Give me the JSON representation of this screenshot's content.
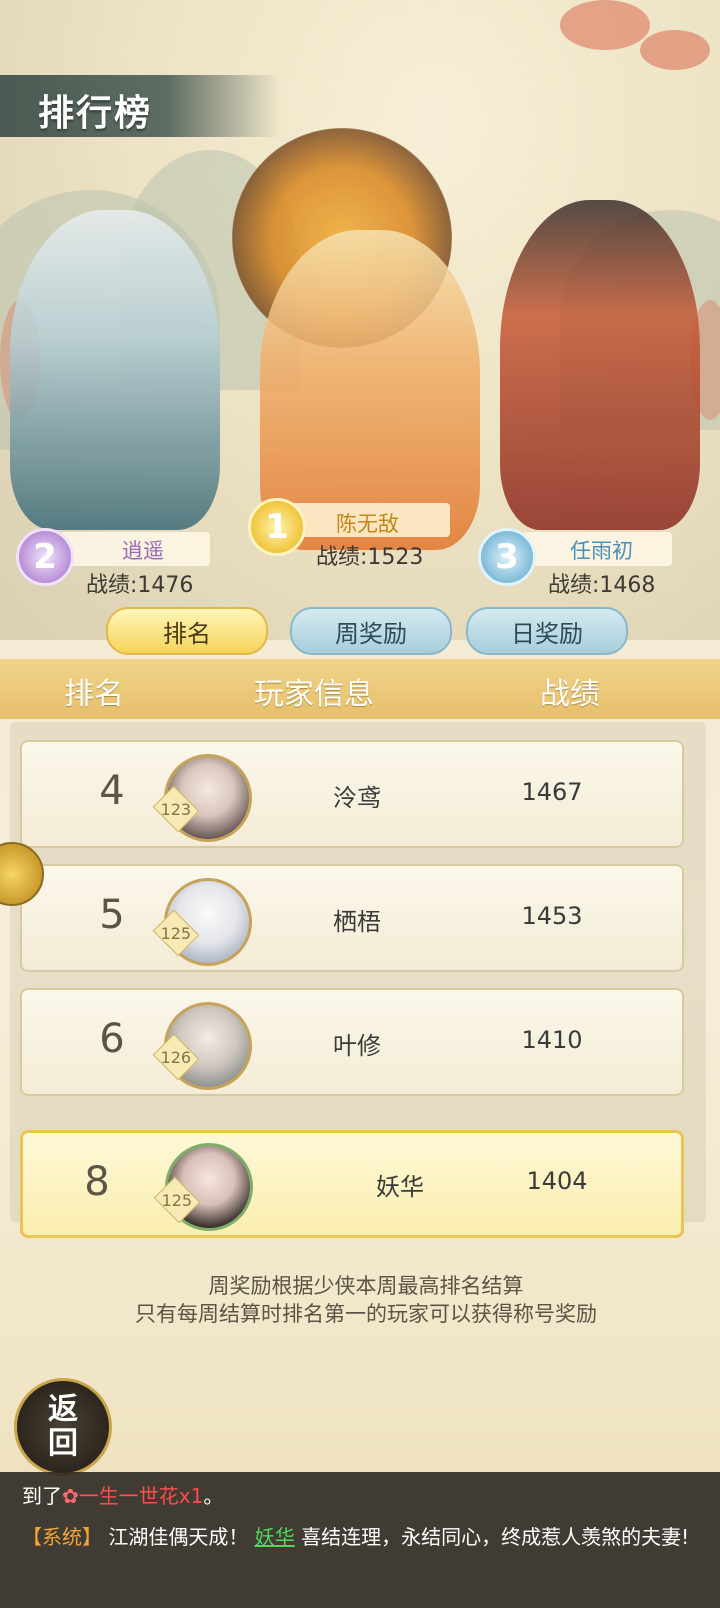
{
  "page": {
    "title": "排行榜"
  },
  "podium": [
    {
      "rank": "1",
      "name": "陈无敌",
      "score_label": "战绩:1523",
      "name_color": "#c7861a"
    },
    {
      "rank": "2",
      "name": "逍遥",
      "score_label": "战绩:1476",
      "name_color": "#9a6ab8"
    },
    {
      "rank": "3",
      "name": "任雨初",
      "score_label": "战绩:1468",
      "name_color": "#4a90b8"
    }
  ],
  "tabs": [
    {
      "label": "排名",
      "active": true
    },
    {
      "label": "周奖励",
      "active": false
    },
    {
      "label": "日奖励",
      "active": false
    }
  ],
  "table": {
    "headers": [
      "排名",
      "玩家信息",
      "战绩"
    ],
    "rows": [
      {
        "rank": "4",
        "level": "123",
        "name": "泠鸢",
        "score": "1467"
      },
      {
        "rank": "5",
        "level": "125",
        "name": "栖梧",
        "score": "1453"
      },
      {
        "rank": "6",
        "level": "126",
        "name": "叶修",
        "score": "1410"
      }
    ],
    "self": {
      "rank": "8",
      "level": "125",
      "name": "妖华",
      "score": "1404"
    }
  },
  "notes": [
    "周奖励根据少侠本周最高排名结算",
    "只有每周结算时排名第一的玩家可以获得称号奖励"
  ],
  "back_button": {
    "line1": "返",
    "line2": "回"
  },
  "chat": {
    "line1_prefix": "到了",
    "line1_item": "一生一世花x1",
    "line1_suffix": "。",
    "line2_tag": "【系统】",
    "line2_text_a": " 江湖佳偶天成！ ",
    "line2_player": "妖华",
    "line2_text_b": " 喜结连理，永结同心，终成惹人羡煞的夫妻!"
  }
}
